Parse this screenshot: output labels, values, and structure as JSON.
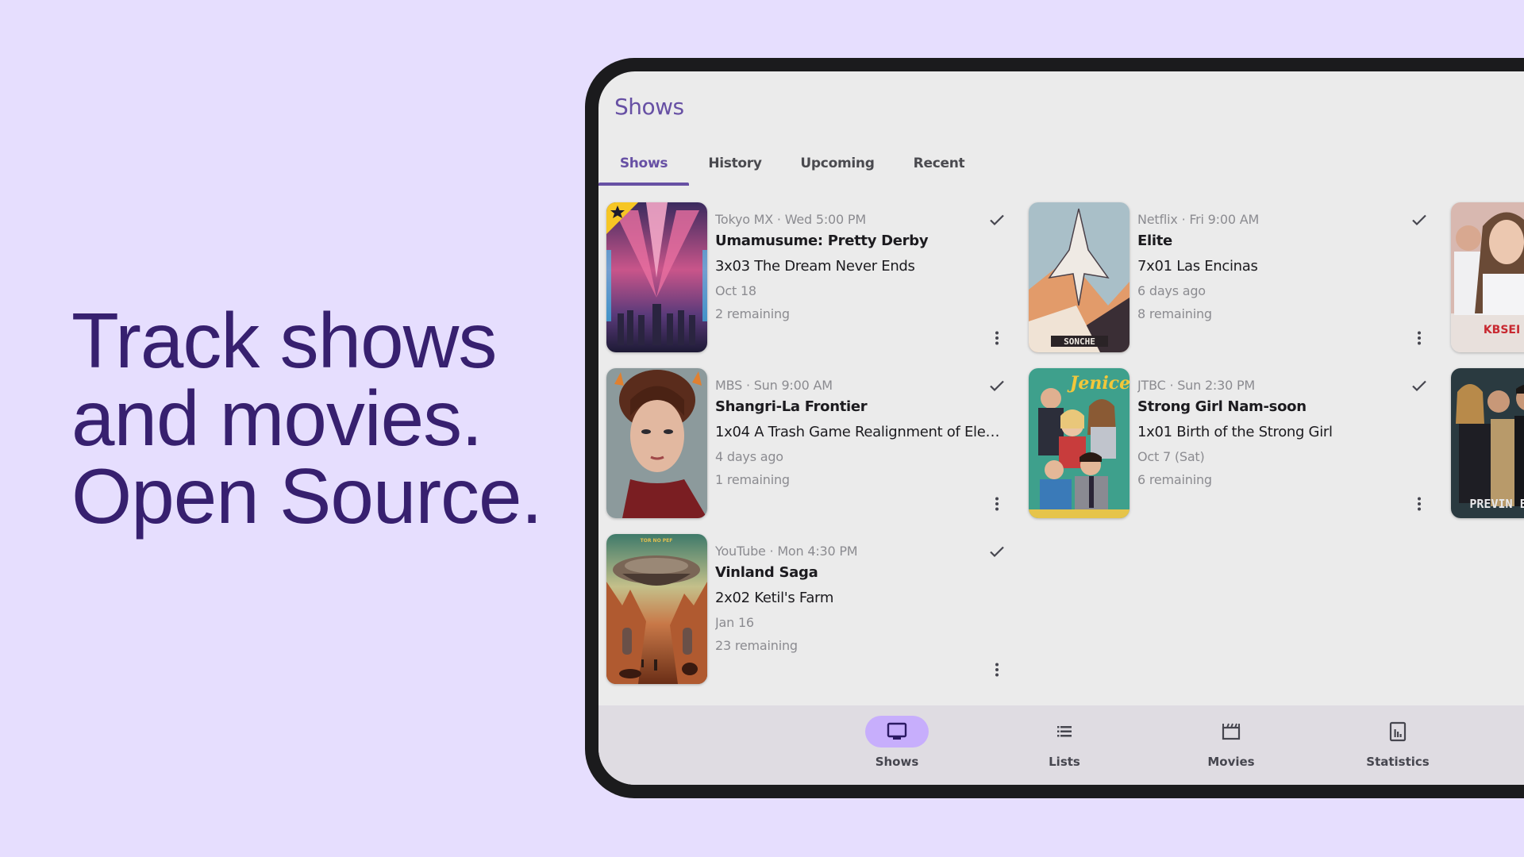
{
  "headline": {
    "lines": [
      "Track shows",
      "and movies.",
      "Open Source."
    ]
  },
  "app": {
    "title": "Shows",
    "accent_color": "#6750a4",
    "tabs": [
      {
        "label": "Shows",
        "active": true
      },
      {
        "label": "History",
        "active": false
      },
      {
        "label": "Upcoming",
        "active": false
      },
      {
        "label": "Recent",
        "active": false
      }
    ],
    "shows": [
      {
        "network": "Tokyo MX · Wed 5:00 PM",
        "title": "Umamusume: Pretty Derby",
        "episode": "3x03 The Dream Never Ends",
        "date": "Oct 18",
        "remaining": "2 remaining",
        "favorite": true,
        "poster_icon": "poster-anime-crowd"
      },
      {
        "network": "Netflix · Fri 9:00 AM",
        "title": "Elite",
        "episode": "7x01 Las Encinas",
        "date": "6 days ago",
        "remaining": "8 remaining",
        "favorite": false,
        "poster_icon": "poster-spaceship"
      },
      {
        "network": "MBS · Sun 9:00 AM",
        "title": "Shangri-La Frontier",
        "episode": "1x04 A Trash Game Realignment of Ele…",
        "date": "4 days ago",
        "remaining": "1 remaining",
        "favorite": false,
        "poster_icon": "poster-portrait"
      },
      {
        "network": "JTBC · Sun 2:30 PM",
        "title": "Strong Girl Nam-soon",
        "episode": "1x01 Birth of the Strong Girl",
        "date": "Oct 7 (Sat)",
        "remaining": "6 remaining",
        "favorite": false,
        "poster_icon": "poster-family-group"
      },
      {
        "network": "YouTube · Mon 4:30 PM",
        "title": "Vinland Saga",
        "episode": "2x02 Ketil's Farm",
        "date": "Jan 16",
        "remaining": "23 remaining",
        "favorite": false,
        "poster_icon": "poster-ufo-desert"
      }
    ],
    "partial_posters": [
      "poster-doctors",
      "poster-detectives"
    ],
    "bottom_nav": [
      {
        "label": "Shows",
        "icon": "tv-icon",
        "active": true
      },
      {
        "label": "Lists",
        "icon": "list-icon",
        "active": false
      },
      {
        "label": "Movies",
        "icon": "clapperboard-icon",
        "active": false
      },
      {
        "label": "Statistics",
        "icon": "chart-icon",
        "active": false
      }
    ]
  }
}
